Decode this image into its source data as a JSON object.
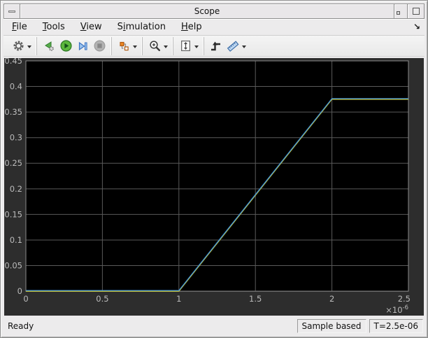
{
  "window": {
    "title": "Scope"
  },
  "menubar": {
    "items": [
      {
        "label": "File",
        "underline": 0
      },
      {
        "label": "Tools",
        "underline": 0
      },
      {
        "label": "View",
        "underline": 0
      },
      {
        "label": "Simulation",
        "underline": 1
      },
      {
        "label": "Help",
        "underline": 0
      }
    ],
    "dock_arrow": "↘"
  },
  "toolbar": {
    "groups": [
      [
        {
          "name": "configuration-properties-button",
          "icon": "gear-icon",
          "dropdown": true
        }
      ],
      [
        {
          "name": "step-back-button",
          "icon": "step-back-icon"
        },
        {
          "name": "run-button",
          "icon": "run-icon"
        },
        {
          "name": "step-forward-button",
          "icon": "step-forward-icon"
        },
        {
          "name": "stop-button",
          "icon": "stop-icon",
          "disabled": true
        }
      ],
      [
        {
          "name": "highlight-simulink-block-button",
          "icon": "simulink-blocks-icon",
          "dropdown": true
        }
      ],
      [
        {
          "name": "zoom-button",
          "icon": "zoom-in-icon",
          "dropdown": true
        }
      ],
      [
        {
          "name": "scale-axes-button",
          "icon": "scale-axes-icon",
          "dropdown": true
        }
      ],
      [
        {
          "name": "triggers-button",
          "icon": "trigger-icon"
        },
        {
          "name": "measurements-button",
          "icon": "ruler-icon",
          "dropdown": true
        }
      ]
    ]
  },
  "chart_data": {
    "type": "line",
    "title": "",
    "xlabel": "",
    "ylabel": "",
    "xlim": [
      0,
      2.5
    ],
    "ylim": [
      0,
      0.45
    ],
    "x_ticks": [
      0,
      0.5,
      1,
      1.5,
      2,
      2.5
    ],
    "x_tick_labels": [
      "0",
      "0.5",
      "1",
      "1.5",
      "2",
      "2.5"
    ],
    "x_multiplier": {
      "base": "×10",
      "exponent": "-6"
    },
    "y_ticks": [
      0,
      0.05,
      0.1,
      0.15,
      0.2,
      0.25,
      0.3,
      0.35,
      0.4,
      0.45
    ],
    "y_tick_labels": [
      "0",
      "0.05",
      "0.1",
      "0.15",
      "0.2",
      "0.25",
      "0.3",
      "0.35",
      "0.4",
      "0.45"
    ],
    "grid": true,
    "legend": null,
    "colors": {
      "panel_background": "#2D2D2D",
      "plot_background": "#000000",
      "grid_line": "#5A5A5A",
      "axes_border": "#8C8C8C",
      "tick_label": "#BBBBBB"
    },
    "series": [
      {
        "name": "signal-1-yellow",
        "color": "#E3DE30",
        "x": [
          0,
          1,
          2,
          2.5
        ],
        "y": [
          0,
          0,
          0.375,
          0.375
        ]
      },
      {
        "name": "signal-2-blue",
        "color": "#3A8BD8",
        "x": [
          0,
          1,
          2,
          2.5
        ],
        "y": [
          0,
          0,
          0.375,
          0.375
        ]
      }
    ]
  },
  "statusbar": {
    "ready": "Ready",
    "sample_mode": "Sample based",
    "time": "T=2.5e-06"
  }
}
